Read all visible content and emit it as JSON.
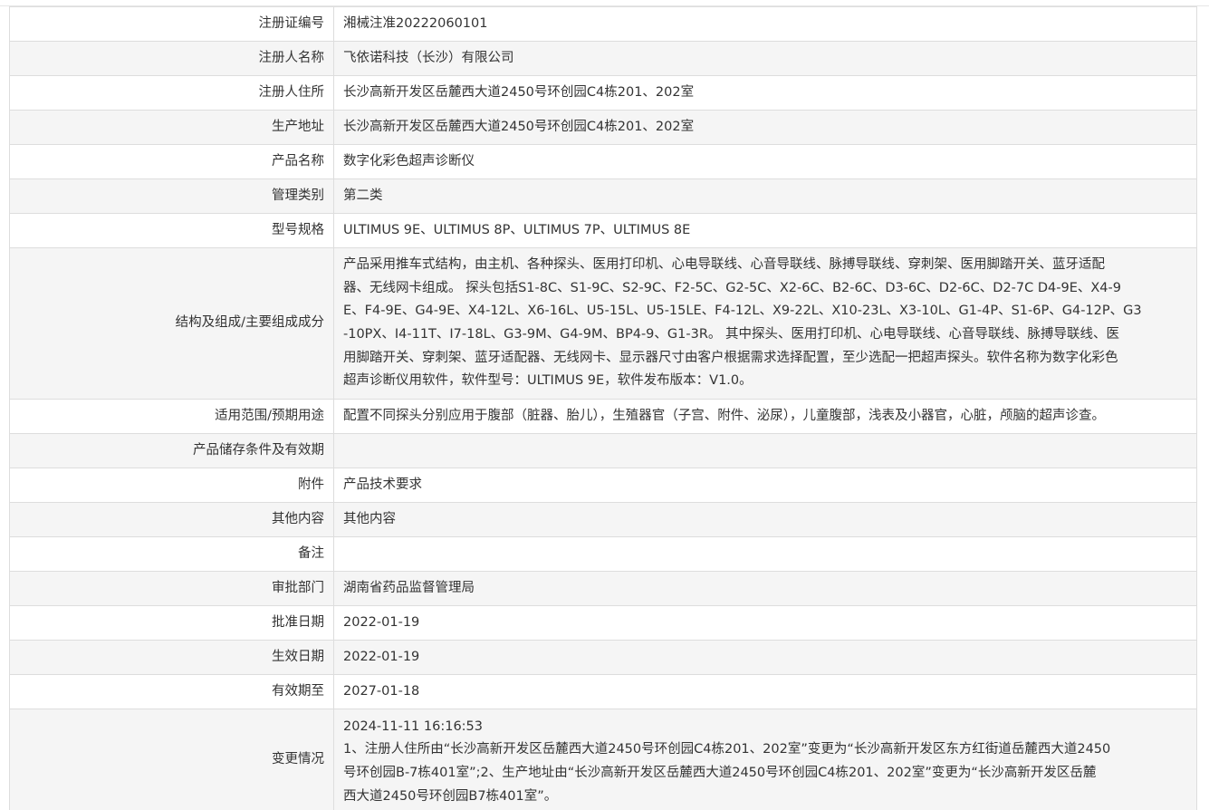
{
  "rows": [
    {
      "label": "注册证编号",
      "value": "湘械注准20222060101"
    },
    {
      "label": "注册人名称",
      "value": "飞依诺科技（长沙）有限公司"
    },
    {
      "label": "注册人住所",
      "value": "长沙高新开发区岳麓西大道2450号环创园C4栋201、202室"
    },
    {
      "label": "生产地址",
      "value": "长沙高新开发区岳麓西大道2450号环创园C4栋201、202室"
    },
    {
      "label": "产品名称",
      "value": "数字化彩色超声诊断仪"
    },
    {
      "label": "管理类别",
      "value": "第二类"
    },
    {
      "label": "型号规格",
      "value": "ULTIMUS 9E、ULTIMUS 8P、ULTIMUS 7P、ULTIMUS 8E"
    },
    {
      "label": "结构及组成/主要组成成分",
      "lines": [
        "产品采用推车式结构，由主机、各种探头、医用打印机、心电导联线、心音导联线、脉搏导联线、穿刺架、医用脚踏开关、蓝牙适配",
        "器、无线网卡组成。 探头包括S1-8C、S1-9C、S2-9C、F2-5C、G2-5C、X2-6C、B2-6C、D3-6C、D2-6C、D2-7C D4-9E、X4-9",
        "E、F4-9E、G4-9E、X4-12L、X6-16L、U5-15L、U5-15LE、F4-12L、X9-22L、X10-23L、X3-10L、G1-4P、S1-6P、G4-12P、G3",
        "-10PX、I4-11T、I7-18L、G3-9M、G4-9M、BP4-9、G1-3R。 其中探头、医用打印机、心电导联线、心音导联线、脉搏导联线、医",
        "用脚踏开关、穿刺架、蓝牙适配器、无线网卡、显示器尺寸由客户根据需求选择配置，至少选配一把超声探头。软件名称为数字化彩色",
        "超声诊断仪用软件，软件型号：ULTIMUS 9E，软件发布版本：V1.0。"
      ]
    },
    {
      "label": "适用范围/预期用途",
      "value": "配置不同探头分别应用于腹部（脏器、胎儿），生殖器官（子宫、附件、泌尿），儿童腹部，浅表及小器官，心脏，颅脑的超声诊查。"
    },
    {
      "label": "产品储存条件及有效期",
      "value": ""
    },
    {
      "label": "附件",
      "value": "产品技术要求"
    },
    {
      "label": "其他内容",
      "value": "其他内容"
    },
    {
      "label": "备注",
      "value": ""
    },
    {
      "label": "审批部门",
      "value": "湖南省药品监督管理局"
    },
    {
      "label": "批准日期",
      "value": "2022-01-19"
    },
    {
      "label": "生效日期",
      "value": "2022-01-19"
    },
    {
      "label": "有效期至",
      "value": "2027-01-18"
    },
    {
      "label": "变更情况",
      "lines": [
        "2024-11-11 16:16:53",
        "1、注册人住所由“长沙高新开发区岳麓西大道2450号环创园C4栋201、202室”变更为“长沙高新开发区东方红街道岳麓西大道2450",
        "号环创园B-7栋401室”;2、生产地址由“长沙高新开发区岳麓西大道2450号环创园C4栋201、202室”变更为“长沙高新开发区岳麓",
        "西大道2450号环创园B7栋401室”。"
      ]
    }
  ]
}
